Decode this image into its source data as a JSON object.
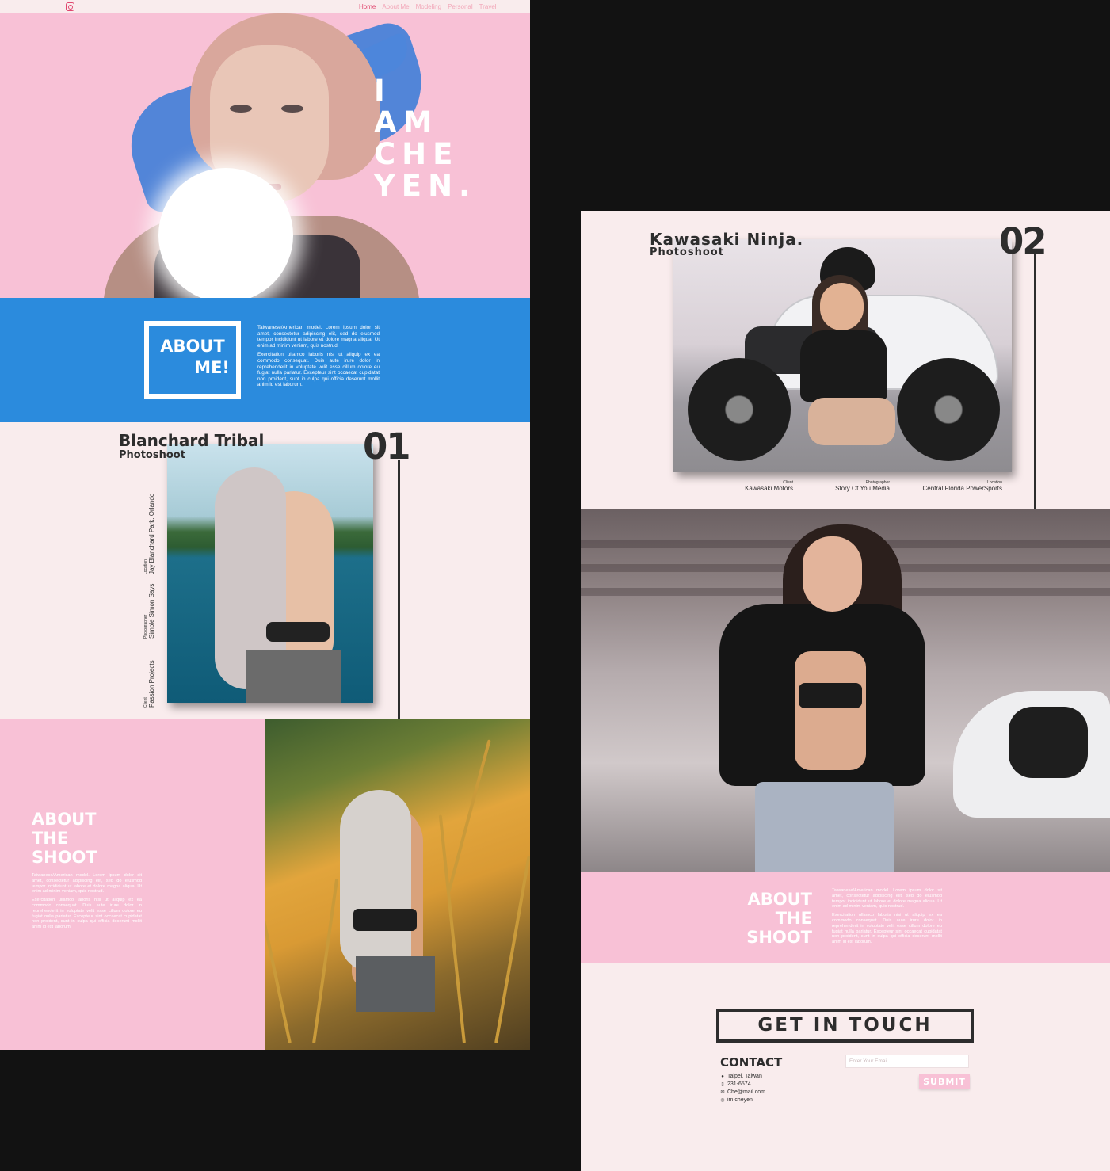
{
  "nav": {
    "items": [
      "Home",
      "About Me",
      "Modeling",
      "Personal",
      "Travel"
    ],
    "active_index": 0
  },
  "hero": {
    "title_lines": [
      "I",
      "AM",
      "CHE",
      "YEN."
    ]
  },
  "about": {
    "heading_line1": "ABOUT",
    "heading_line2": "ME!",
    "paragraph1": "Taiwanese/American model. Lorem ipsum dolor sit amet, consectetur adipiscing elit, sed do eiusmod tempor incididunt ut labore et dolore magna aliqua. Ut enim ad minim veniam, quis nostrud.",
    "paragraph2": "Exercitation ullamco laboris nisi ut aliquip ex ea commodo consequat. Duis aute irure dolor in reprehenderit in voluptate velit esse cillum dolore eu fugiat nulla pariatur. Excepteur sint occaecat cupidatat non proident, sunt in culpa qui officia deserunt mollit anim id est laborum."
  },
  "shoot1": {
    "title": "Blanchard Tribal",
    "subtitle": "Photoshoot",
    "number": "01",
    "credits": [
      {
        "label": "Client",
        "value": "Passion Projects"
      },
      {
        "label": "Photographer",
        "value": "Simple Simon Says"
      },
      {
        "label": "Location",
        "value": "Jay Blanchard Park, Orlando"
      }
    ],
    "about_title": [
      "ABOUT",
      "THE",
      "SHOOT"
    ],
    "about_p1": "Taiwanese/American model. Lorem ipsum dolor sit amet, consectetur adipiscing elit, sed do eiusmod tempor incididunt ut labore et dolore magna aliqua. Ut enim ad minim veniam, quis nostrud.",
    "about_p2": "Exercitation ullamco laboris nisi ut aliquip ex ea commodo consequat. Duis aute irure dolor in reprehenderit in voluptate velit esse cillum dolore eu fugiat nulla pariatur. Excepteur sint occaecat cupidatat non proident, sunt in culpa qui officia deserunt mollit anim id est laborum."
  },
  "shoot2": {
    "title": "Kawasaki Ninja.",
    "subtitle": "Photoshoot",
    "number": "02",
    "credits": [
      {
        "label": "Client",
        "value": "Kawasaki Motors"
      },
      {
        "label": "Photographer",
        "value": "Story Of You Media"
      },
      {
        "label": "Location",
        "value": "Central Florida PowerSports"
      }
    ],
    "about_title": [
      "ABOUT",
      "THE",
      "SHOOT"
    ],
    "about_p1": "Taiwanese/American model. Lorem ipsum dolor sit amet, consectetur adipiscing elit, sed do eiusmod tempor incididunt ut labore et dolore magna aliqua. Ut enim ad minim veniam, quis nostrud.",
    "about_p2": "Exercitation ullamco laboris nisi ut aliquip ex ea commodo consequat. Duis aute irure dolor in reprehenderit in voluptate velit esse cillum dolore eu fugiat nulla pariatur. Excepteur sint occaecat cupidatat non proident, sunt in culpa qui officia deserunt mollit anim id est laborum."
  },
  "contact": {
    "heading": "GET IN TOUCH",
    "title": "CONTACT",
    "items": [
      {
        "icon": "map-pin-icon",
        "text": "Taipei, Taiwan"
      },
      {
        "icon": "phone-icon",
        "text": "231-6574"
      },
      {
        "icon": "mail-icon",
        "text": "Che@mail.com"
      },
      {
        "icon": "instagram-icon",
        "text": "im.cheyen"
      }
    ],
    "email_placeholder": "Enter Your Email",
    "submit_label": "SUBMIT"
  },
  "colors": {
    "pink": "#f8c1d6",
    "blue": "#2b8bdd",
    "blush": "#f9eced",
    "dark": "#2d2d2d",
    "accent": "#e0476f"
  }
}
